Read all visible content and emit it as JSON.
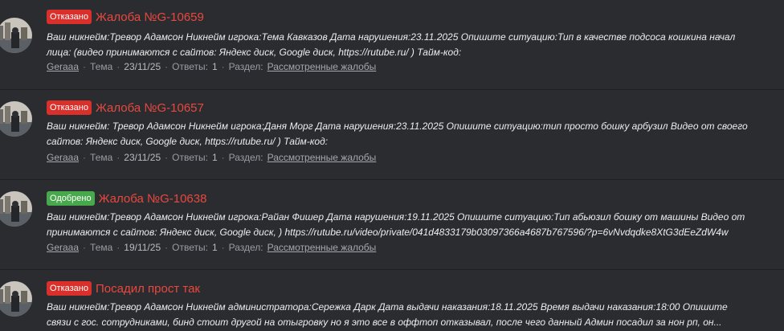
{
  "colors": {
    "background": "#2b2c30",
    "title_red": "#e8483f",
    "badge_denied": "#d9302c",
    "badge_approved": "#48a94c"
  },
  "results": [
    {
      "status": "Отказано",
      "status_type": "denied",
      "title": "Жалоба №G-10659",
      "line1": "Ваш никнейм:Тревор Адамсон Никнейм игрока:Тема Кавказов Дата нарушения:23.11.2025 Опишите ситуацию:Тип в качестве подсоса кошкина начал",
      "line2": "лица: (видео принимаются с сайтов: Яндекс диск, Google диск, https://rutube.ru/ ) Тайм-код:",
      "user": "Geraaa",
      "thread_label": "Тема",
      "date": "23/11/25",
      "replies_label": "Ответы:",
      "replies": "1",
      "forum_label": "Раздел:",
      "forum": "Рассмотренные жалобы"
    },
    {
      "status": "Отказано",
      "status_type": "denied",
      "title": "Жалоба №G-10657",
      "line1": "Ваш никнейм: Тревор Адамсон Никнейм игрока:Даня Морг Дата нарушения:23.11.2025 Опишите ситуацию:тип просто бошку арбузил Видео от своего",
      "line2": "сайтов: Яндекс диск, Google диск, https://rutube.ru/ ) Тайм-код:",
      "user": "Geraaa",
      "thread_label": "Тема",
      "date": "23/11/25",
      "replies_label": "Ответы:",
      "replies": "1",
      "forum_label": "Раздел:",
      "forum": "Рассмотренные жалобы"
    },
    {
      "status": "Одобрено",
      "status_type": "approved",
      "title": "Жалоба №G-10638",
      "line1": "Ваш никнейм:Тревор Адамсон Никнейм игрока:Райан Фишер Дата нарушения:19.11.2025 Опишите ситуацию:Тип абьюзил бошку от машины Видео от",
      "line2": "принимаются с сайтов: Яндекс диск, Google диск, ) https://rutube.ru/video/private/041d4833179b03097366a4687b767596/?p=6vNvdqdke8XtG3dEeZdW4w",
      "user": "Geraaa",
      "thread_label": "Тема",
      "date": "19/11/25",
      "replies_label": "Ответы:",
      "replies": "1",
      "forum_label": "Раздел:",
      "forum": "Рассмотренные жалобы"
    },
    {
      "status": "Отказано",
      "status_type": "denied",
      "title": "Посадил прост так",
      "line1": "Ваш никнейм:Тревор Адамсон Никнейм администратора:Сережка Дарк Дата выдачи наказания:18.11.2025 Время выдачи наказания:18:00 Опишите",
      "line2": "связи с гос. сотрудниками, бинд стоит другой на отыгровку но я это все в оффтоп отказывал, после чего данный Админ посадил за нон рп, он...",
      "user": "",
      "thread_label": "",
      "date": "",
      "replies_label": "",
      "replies": "",
      "forum_label": "",
      "forum": ""
    }
  ]
}
